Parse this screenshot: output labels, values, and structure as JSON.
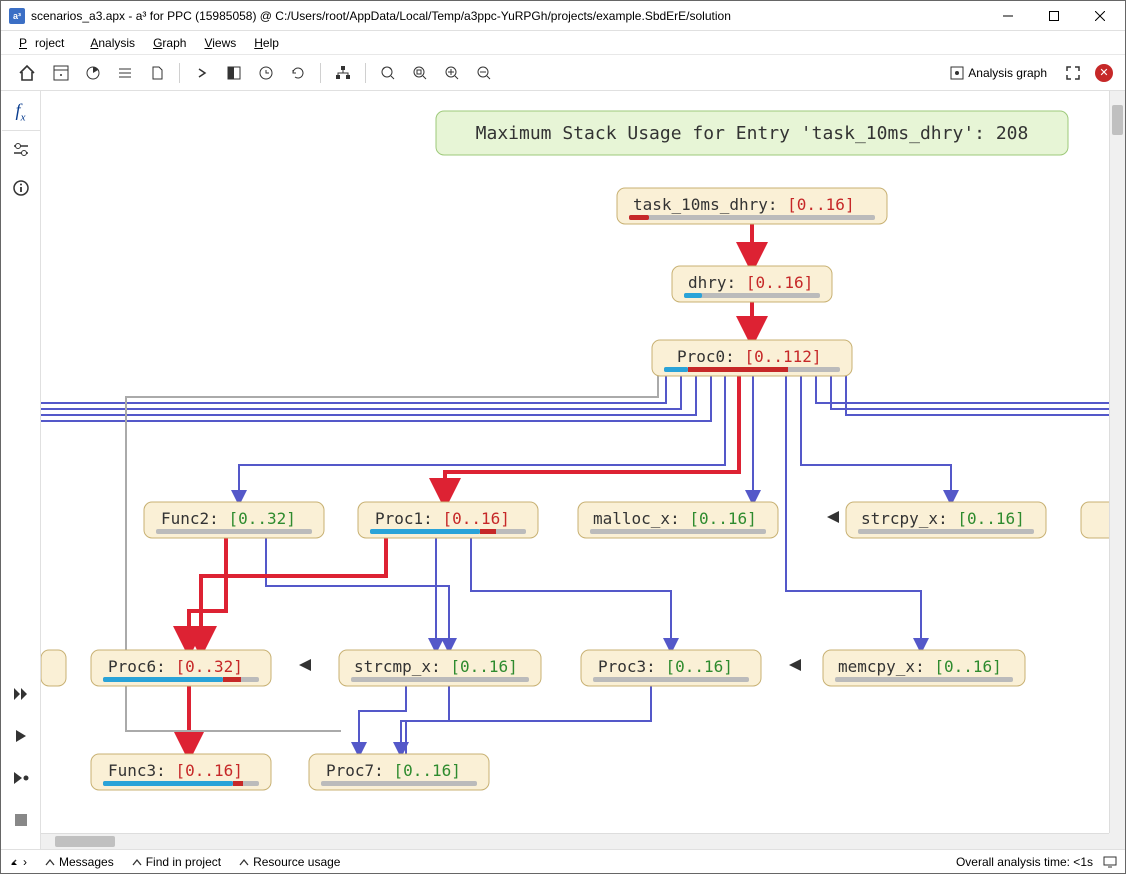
{
  "titlebar": {
    "app_icon_text": "a³",
    "text": "scenarios_a3.apx - a³ for PPC (15985058) @ C:/Users/root/AppData/Local/Temp/a3ppc-YuRPGh/projects/example.SbdErE/solution"
  },
  "menubar": [
    "Project",
    "Analysis",
    "Graph",
    "Views",
    "Help"
  ],
  "toolbar_right": {
    "analysis_graph": "Analysis graph"
  },
  "banner": "Maximum Stack Usage for Entry 'task_10ms_dhry': 208",
  "nodes": {
    "task": {
      "name": "task_10ms_dhry:",
      "range": "[0..16]",
      "color": "red"
    },
    "dhry": {
      "name": "dhry:",
      "range": "[0..16]",
      "color": "red"
    },
    "proc0": {
      "name": "Proc0:",
      "range": "[0..112]",
      "color": "red"
    },
    "func2": {
      "name": "Func2:",
      "range": "[0..32]",
      "color": "green"
    },
    "proc1": {
      "name": "Proc1:",
      "range": "[0..16]",
      "color": "red"
    },
    "mallocx": {
      "name": "malloc_x:",
      "range": "[0..16]",
      "color": "green"
    },
    "strcpyx": {
      "name": "strcpy_x:",
      "range": "[0..16]",
      "color": "green"
    },
    "proc6": {
      "name": "Proc6:",
      "range": "[0..32]",
      "color": "red"
    },
    "strcmpx": {
      "name": "strcmp_x:",
      "range": "[0..16]",
      "color": "green"
    },
    "proc3": {
      "name": "Proc3:",
      "range": "[0..16]",
      "color": "green"
    },
    "memcpyx": {
      "name": "memcpy_x:",
      "range": "[0..16]",
      "color": "green"
    },
    "func3": {
      "name": "Func3:",
      "range": "[0..16]",
      "color": "red"
    },
    "proc7": {
      "name": "Proc7:",
      "range": "[0..16]",
      "color": "green"
    }
  },
  "statusbar": {
    "messages": "Messages",
    "find": "Find in project",
    "resource": "Resource usage",
    "analysis_time": "Overall analysis time: <1s"
  }
}
